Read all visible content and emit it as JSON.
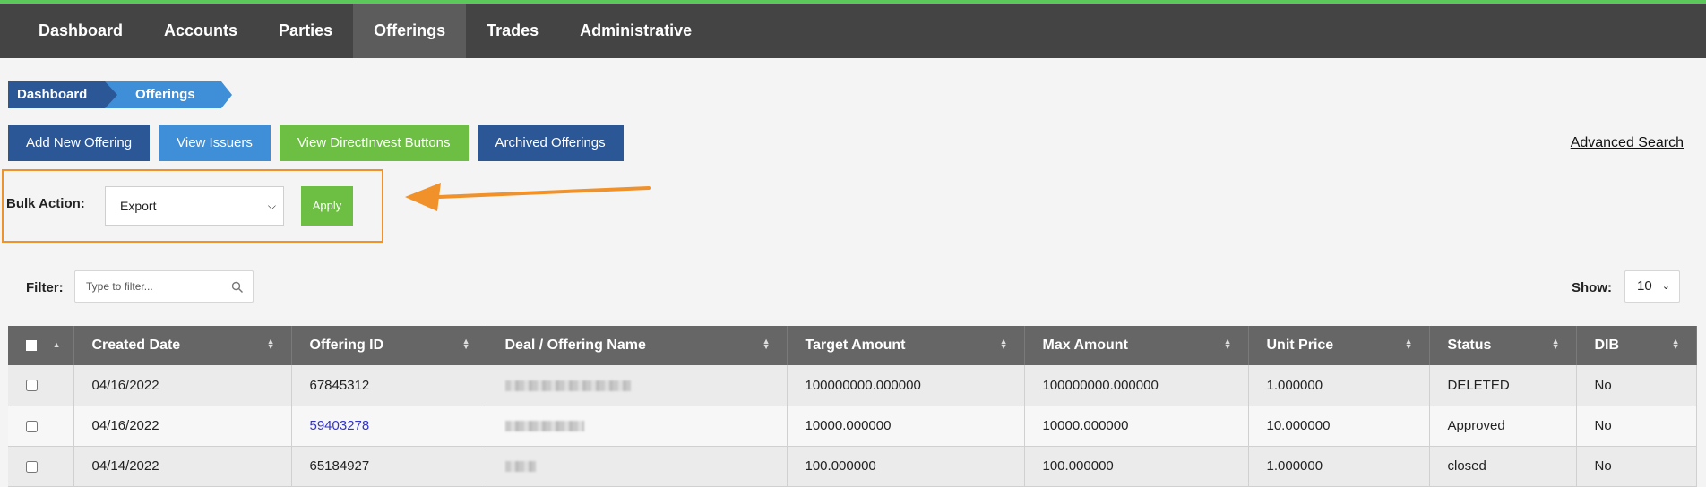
{
  "nav": {
    "items": [
      {
        "label": "Dashboard"
      },
      {
        "label": "Accounts"
      },
      {
        "label": "Parties"
      },
      {
        "label": "Offerings"
      },
      {
        "label": "Trades"
      },
      {
        "label": "Administrative"
      }
    ],
    "active": "Offerings"
  },
  "breadcrumb": {
    "home": "Dashboard",
    "current": "Offerings"
  },
  "actions": {
    "add_new": "Add New Offering",
    "view_issuers": "View Issuers",
    "view_directinvest": "View DirectInvest Buttons",
    "archived": "Archived Offerings",
    "advanced_search": "Advanced Search"
  },
  "bulk": {
    "label": "Bulk Action:",
    "selected": "Export",
    "apply": "Apply"
  },
  "filter": {
    "label": "Filter:",
    "placeholder": "Type to filter..."
  },
  "show": {
    "label": "Show:",
    "value": "10"
  },
  "table": {
    "headers": [
      "Created Date",
      "Offering ID",
      "Deal / Offering Name",
      "Target Amount",
      "Max Amount",
      "Unit Price",
      "Status",
      "DIB"
    ],
    "rows": [
      {
        "created": "04/16/2022",
        "id": "67845312",
        "id_link": false,
        "target": "100000000.000000",
        "max": "100000000.000000",
        "price": "1.000000",
        "status": "DELETED",
        "dib": "No"
      },
      {
        "created": "04/16/2022",
        "id": "59403278",
        "id_link": true,
        "target": "10000.000000",
        "max": "10000.000000",
        "price": "10.000000",
        "status": "Approved",
        "dib": "No"
      },
      {
        "created": "04/14/2022",
        "id": "65184927",
        "id_link": false,
        "target": "100.000000",
        "max": "100.000000",
        "price": "1.000000",
        "status": "closed",
        "dib": "No"
      }
    ]
  },
  "colors": {
    "nav_bg": "#444444",
    "nav_accent": "#5cc85c",
    "primary": "#2b5797",
    "secondary": "#3f8ed8",
    "success": "#6cbf43",
    "highlight": "#f0912a",
    "link": "#3333cc"
  },
  "icons": [
    "search-icon",
    "chevron-down-icon",
    "sort-icon",
    "arrow-annotation-icon"
  ]
}
